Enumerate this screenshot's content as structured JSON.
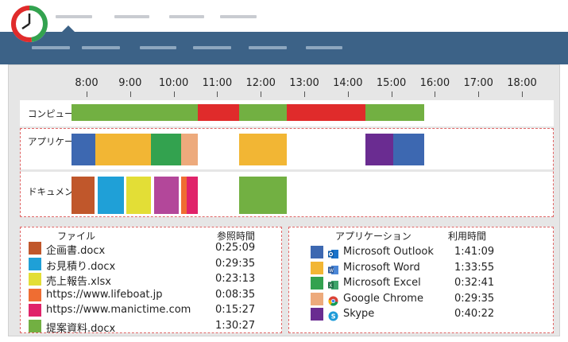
{
  "colors": {
    "navbar": "#3c6287",
    "usage_active": "#72b042",
    "usage_idle": "#e02b2b",
    "dashed_border": "#e06666"
  },
  "header": {
    "logo": "clock-logo-icon",
    "top_nav_placeholders": 4,
    "sub_nav_placeholders": 6
  },
  "timeline": {
    "hours": [
      "8:00",
      "9:00",
      "10:00",
      "11:00",
      "12:00",
      "13:00",
      "14:00",
      "15:00",
      "16:00",
      "17:00",
      "18:00"
    ],
    "rows": {
      "computer_usage": {
        "label": "コンピュータ使用",
        "segments": [
          {
            "start": 7.65,
            "end": 10.55,
            "color": "#72b042"
          },
          {
            "start": 10.55,
            "end": 11.5,
            "color": "#e02b2b"
          },
          {
            "start": 11.5,
            "end": 12.6,
            "color": "#72b042"
          },
          {
            "start": 12.6,
            "end": 14.4,
            "color": "#e02b2b"
          },
          {
            "start": 14.4,
            "end": 15.75,
            "color": "#72b042"
          }
        ]
      },
      "applications": {
        "label": "アプリケーション",
        "segments": [
          {
            "start": 7.65,
            "end": 8.2,
            "color": "#3d68b1"
          },
          {
            "start": 8.2,
            "end": 9.48,
            "color": "#f2b634"
          },
          {
            "start": 9.48,
            "end": 10.18,
            "color": "#33a24f"
          },
          {
            "start": 10.18,
            "end": 10.55,
            "color": "#edaa7c"
          },
          {
            "start": 11.5,
            "end": 12.6,
            "color": "#f2b634"
          },
          {
            "start": 14.4,
            "end": 15.05,
            "color": "#6a2c91"
          },
          {
            "start": 15.05,
            "end": 15.75,
            "color": "#3d68b1"
          }
        ]
      },
      "documents": {
        "label": "ドキュメント",
        "segments": [
          {
            "start": 7.65,
            "end": 8.18,
            "color": "#c0572b"
          },
          {
            "start": 8.25,
            "end": 8.86,
            "color": "#1fa0d7"
          },
          {
            "start": 8.92,
            "end": 9.48,
            "color": "#e3de36"
          },
          {
            "start": 9.55,
            "end": 10.12,
            "color": "#b3479a"
          },
          {
            "start": 10.18,
            "end": 10.3,
            "color": "#ef6d32"
          },
          {
            "start": 10.3,
            "end": 10.55,
            "color": "#e0236a"
          },
          {
            "start": 11.5,
            "end": 12.6,
            "color": "#72b042"
          }
        ]
      }
    }
  },
  "files_panel": {
    "col_name": "ファイル",
    "col_time": "参照時間",
    "items": [
      {
        "name": "企画書.docx",
        "time": "0:25:09",
        "color": "#c0572b"
      },
      {
        "name": "お見積り.docx",
        "time": "0:29:35",
        "color": "#1fa0d7"
      },
      {
        "name": "売上報告.xlsx",
        "time": "0:23:13",
        "color": "#e3de36"
      },
      {
        "name": "https://www.lifeboat.jp",
        "time": "0:08:35",
        "color": "#ef6d32"
      },
      {
        "name": "https://www.manictime.com",
        "time": "0:15:27",
        "color": "#e0236a"
      },
      {
        "name": "提案資料.docx",
        "time": "1:30:27",
        "color": "#72b042"
      }
    ]
  },
  "apps_panel": {
    "col_name": "アプリケーション",
    "col_time": "利用時間",
    "items": [
      {
        "name": "Microsoft Outlook",
        "time": "1:41:09",
        "color": "#3d68b1",
        "icon": "outlook-icon"
      },
      {
        "name": "Microsoft Word",
        "time": "1:33:55",
        "color": "#f2b634",
        "icon": "word-icon"
      },
      {
        "name": "Microsoft Excel",
        "time": "0:32:41",
        "color": "#33a24f",
        "icon": "excel-icon"
      },
      {
        "name": "Google Chrome",
        "time": "0:29:35",
        "color": "#edaa7c",
        "icon": "chrome-icon"
      },
      {
        "name": "Skype",
        "time": "0:40:22",
        "color": "#6a2c91",
        "icon": "skype-icon"
      }
    ]
  }
}
